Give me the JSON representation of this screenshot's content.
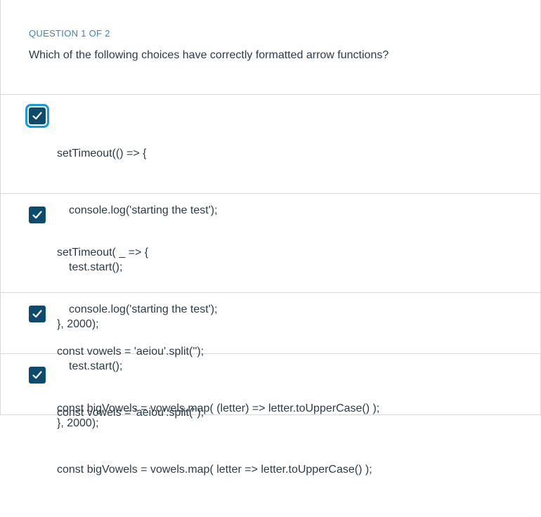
{
  "question": {
    "number_label": "QUESTION 1 OF 2",
    "text": "Which of the following choices have correctly formatted arrow functions?"
  },
  "choices": [
    {
      "checked": true,
      "focused": true,
      "lines": [
        "setTimeout(() => {",
        "console.log('starting the test');",
        "test.start();",
        "}, 2000);"
      ]
    },
    {
      "checked": true,
      "focused": false,
      "lines": [
        "setTimeout( _ => {",
        "console.log('starting the test');",
        "test.start();",
        "}, 2000);"
      ]
    },
    {
      "checked": true,
      "focused": false,
      "lines": [
        "const vowels = 'aeiou'.split('');",
        "const bigVowels = vowels.map( (letter) => letter.toUpperCase() );"
      ]
    },
    {
      "checked": true,
      "focused": false,
      "lines": [
        "const vowels = 'aeiou'.split('');",
        "const bigVowels = vowels.map( letter => letter.toUpperCase() );"
      ]
    }
  ],
  "colors": {
    "accent": "#0e4a6b",
    "focus_ring": "#1b9bd6",
    "question_number": "#3a86b5",
    "divider": "#d6dadd"
  },
  "icons": {
    "checkbox": "checkmark-icon"
  }
}
